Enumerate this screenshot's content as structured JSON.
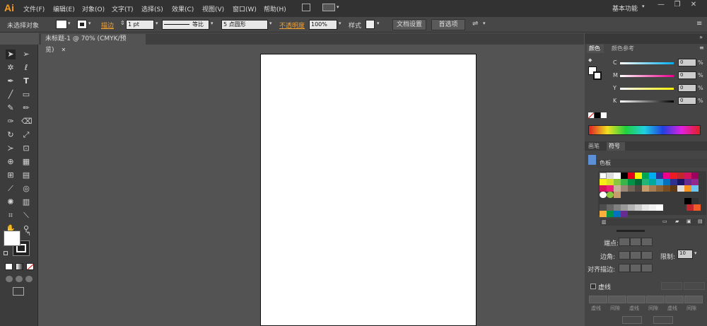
{
  "app": {
    "logo": "Ai",
    "workspace": "基本功能"
  },
  "menu": [
    "文件(F)",
    "编辑(E)",
    "对象(O)",
    "文字(T)",
    "选择(S)",
    "效果(C)",
    "视图(V)",
    "窗口(W)",
    "帮助(H)"
  ],
  "control": {
    "selection": "未选择对象",
    "stroke_label": "描边",
    "stroke_weight": "1 pt",
    "profile": "等比",
    "brush": "5 点圆形",
    "opacity_label": "不透明度",
    "opacity": "100%",
    "style_label": "样式",
    "doc_setup": "文档设置",
    "prefs": "首选项"
  },
  "document": {
    "tab_title": "未标题-1 @ 70% (CMYK/预览)"
  },
  "color_panel": {
    "tabs": [
      "颜色",
      "颜色参考"
    ],
    "channels": [
      {
        "name": "C",
        "value": "0"
      },
      {
        "name": "M",
        "value": "0"
      },
      {
        "name": "Y",
        "value": "0"
      },
      {
        "name": "K",
        "value": "0"
      }
    ]
  },
  "swatch_panel": {
    "tabs": [
      "画笔",
      "符号"
    ],
    "title": "色板"
  },
  "stroke_panel": {
    "cap_label": "端点:",
    "corner_label": "边角:",
    "limit_label": "限制:",
    "limit_value": "10",
    "align_label": "对齐描边:",
    "dashed_label": "虚线",
    "dash_labels": [
      "虚线",
      "间隙",
      "虚线",
      "间隙",
      "虚线",
      "间隙"
    ]
  },
  "colors": {
    "accent": "#f49a21",
    "menubar": "#323232",
    "panel": "#454545",
    "canvas": "#535353"
  }
}
